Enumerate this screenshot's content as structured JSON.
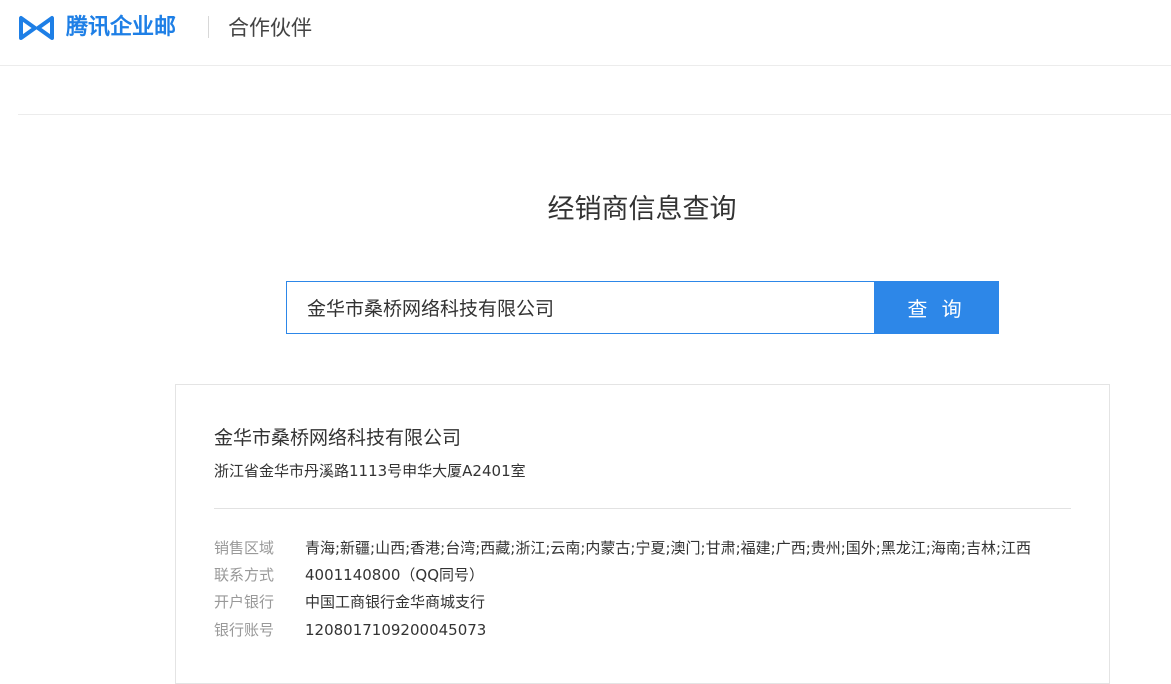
{
  "header": {
    "brand_name": "腾讯企业邮",
    "subtitle": "合作伙伴"
  },
  "page": {
    "title": "经销商信息查询"
  },
  "search": {
    "value": "金华市桑桥网络科技有限公司",
    "button_label": "查 询"
  },
  "result": {
    "company_name": "金华市桑桥网络科技有限公司",
    "address": "浙江省金华市丹溪路1113号申华大厦A2401室",
    "fields": {
      "sales_region": {
        "label": "销售区域",
        "value": "青海;新疆;山西;香港;台湾;西藏;浙江;云南;内蒙古;宁夏;澳门;甘肃;福建;广西;贵州;国外;黑龙江;海南;吉林;江西"
      },
      "contact": {
        "label": "联系方式",
        "value": "4001140800（QQ同号）"
      },
      "bank": {
        "label": "开户银行",
        "value": "中国工商银行金华商城支行"
      },
      "account": {
        "label": "银行账号",
        "value": "1208017109200045073"
      }
    }
  },
  "colors": {
    "brand_blue": "#1e7fe6",
    "button_blue": "#2d87e8"
  },
  "icons": {
    "logo": "tencent-exmail-logo-icon"
  }
}
